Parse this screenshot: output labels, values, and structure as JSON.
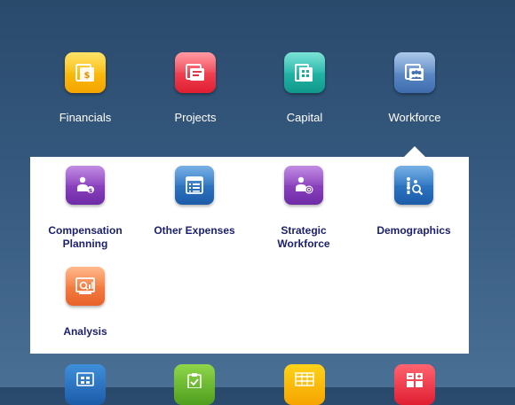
{
  "top_apps": [
    {
      "label": "Financials",
      "icon": "financials-icon",
      "color_top": "#ffd31a",
      "color_bottom": "#f5a300"
    },
    {
      "label": "Projects",
      "icon": "projects-icon",
      "color_top": "#ff6470",
      "color_bottom": "#e01e32"
    },
    {
      "label": "Capital",
      "icon": "capital-icon",
      "color_top": "#35d1c0",
      "color_bottom": "#10988c"
    },
    {
      "label": "Workforce",
      "icon": "workforce-icon",
      "color_top": "#7fa9dd",
      "color_bottom": "#3d6cae"
    }
  ],
  "workforce_panel": {
    "cards": [
      {
        "label": "Compensation\nPlanning",
        "icon": "compensation-planning-icon",
        "color_top": "#a65ad6",
        "color_bottom": "#6f2aa6"
      },
      {
        "label": "Other Expenses",
        "icon": "other-expenses-icon",
        "color_top": "#3f8fdb",
        "color_bottom": "#1c5ba8"
      },
      {
        "label": "Strategic\nWorkforce",
        "icon": "strategic-workforce-icon",
        "color_top": "#a65ad6",
        "color_bottom": "#6f2aa6"
      },
      {
        "label": "Demographics",
        "icon": "demographics-icon",
        "color_top": "#3f8fdb",
        "color_bottom": "#1c5ba8"
      },
      {
        "label": "Analysis",
        "icon": "analysis-icon",
        "color_top": "#ff9a5a",
        "color_bottom": "#e8612a"
      }
    ]
  },
  "bottom_apps": [
    {
      "icon": "grid-tile-icon",
      "color_top": "#3f8fdb",
      "color_bottom": "#1c5ba8"
    },
    {
      "icon": "clipboard-tile-icon",
      "color_top": "#8fd64a",
      "color_bottom": "#4f9e1e"
    },
    {
      "icon": "table-tile-icon",
      "color_top": "#ffd31a",
      "color_bottom": "#f5a300"
    },
    {
      "icon": "calculator-tile-icon",
      "color_top": "#ff6470",
      "color_bottom": "#e01e32"
    }
  ]
}
